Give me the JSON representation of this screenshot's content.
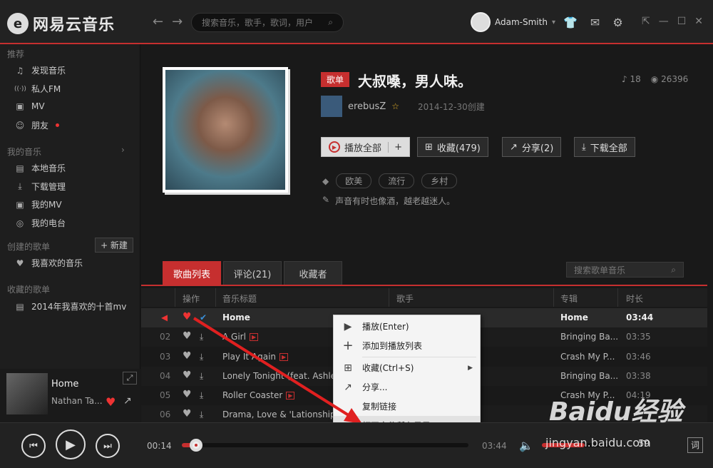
{
  "app": {
    "name": "网易云音乐",
    "logo_glyph": "e"
  },
  "nav": {
    "back": "←",
    "forward": "→"
  },
  "search": {
    "placeholder": "搜索音乐，歌手，歌词，用户"
  },
  "user": {
    "name": "Adam-Smith"
  },
  "sidebar": {
    "recommend_title": "推荐",
    "recommend": [
      {
        "icon": "music-note-icon",
        "glyph": "♫",
        "label": "发现音乐"
      },
      {
        "icon": "radio-icon",
        "glyph": "((·))",
        "label": "私人FM"
      },
      {
        "icon": "mv-icon",
        "glyph": "▣",
        "label": "MV"
      },
      {
        "icon": "friends-icon",
        "glyph": "☺",
        "label": "朋友"
      }
    ],
    "my_music_title": "我的音乐",
    "my_music": [
      {
        "icon": "local-music-icon",
        "glyph": "▤",
        "label": "本地音乐"
      },
      {
        "icon": "download-icon",
        "glyph": "⤓",
        "label": "下载管理"
      },
      {
        "icon": "mv-icon",
        "glyph": "▣",
        "label": "我的MV"
      },
      {
        "icon": "radio-station-icon",
        "glyph": "◎",
        "label": "我的电台"
      }
    ],
    "created_title": "创建的歌单",
    "new_button": "+ 新建",
    "created": [
      {
        "icon": "heart-icon",
        "glyph": "♥",
        "label": "我喜欢的音乐"
      }
    ],
    "collected_title": "收藏的歌单",
    "collected": [
      {
        "icon": "playlist-icon",
        "glyph": "▤",
        "label": "2014年我喜欢的十首mv"
      }
    ]
  },
  "now_playing": {
    "title": "Home",
    "artist": "Nathan Ta..."
  },
  "playlist": {
    "badge": "歌单",
    "title": "大叔嗓，男人味。",
    "song_count": "18",
    "play_count": "26396",
    "creator": "erebusZ",
    "created_date": "2014-12-30创建",
    "actions": {
      "play_all": "播放全部",
      "add": "+",
      "collect": "收藏(479)",
      "share": "分享(2)",
      "download": "下载全部"
    },
    "tags": [
      "欧美",
      "流行",
      "乡村"
    ],
    "description": "声音有时也像酒，越老越迷人。"
  },
  "tabs": [
    "歌曲列表",
    "评论(21)",
    "收藏者"
  ],
  "song_search": {
    "placeholder": "搜索歌单音乐"
  },
  "table": {
    "headers": {
      "ops": "操作",
      "title": "音乐标题",
      "artist": "歌手",
      "album": "专辑",
      "duration": "时长"
    },
    "rows": [
      {
        "num": "",
        "title": "Home",
        "album": "Home",
        "duration": "03:44",
        "mv": false
      },
      {
        "num": "02",
        "title": "A Girl",
        "album": "Bringing Ba...",
        "duration": "03:35",
        "mv": true
      },
      {
        "num": "03",
        "title": "Play It Again",
        "album": "Crash My P...",
        "duration": "03:46",
        "mv": true
      },
      {
        "num": "04",
        "title": "Lonely Tonight (feat. Ashley M",
        "album": "Bringing Ba...",
        "duration": "03:38",
        "mv": false
      },
      {
        "num": "05",
        "title": "Roller Coaster",
        "album": "Crash My P...",
        "duration": "04:19",
        "mv": true
      },
      {
        "num": "06",
        "title": "Drama, Love & 'Lationships",
        "album": "",
        "duration": "",
        "mv": false
      }
    ]
  },
  "context_menu": [
    {
      "icon": "play-circle-icon",
      "glyph": "▶",
      "label": "播放(Enter)"
    },
    {
      "icon": "plus-icon",
      "glyph": "+",
      "label": "添加到播放列表"
    },
    {
      "icon": "collect-icon",
      "glyph": "⊞",
      "label": "收藏(Ctrl+S)",
      "submenu": true
    },
    {
      "icon": "share-icon",
      "glyph": "↗",
      "label": "分享..."
    },
    {
      "icon": "link-icon",
      "glyph": "",
      "label": "复制链接"
    },
    {
      "icon": "folder-icon",
      "glyph": "▭",
      "label": "打开文件所在目录"
    }
  ],
  "player": {
    "current_time": "00:14",
    "total_time": "03:44",
    "progress": 0.05,
    "volume": 0.6,
    "lyric_button": "词",
    "count": "59"
  },
  "colors": {
    "accent": "#c62f2f",
    "background": "#191919"
  },
  "watermark": {
    "brand": "Baidu经验",
    "url": "jingyan.baidu.com"
  }
}
